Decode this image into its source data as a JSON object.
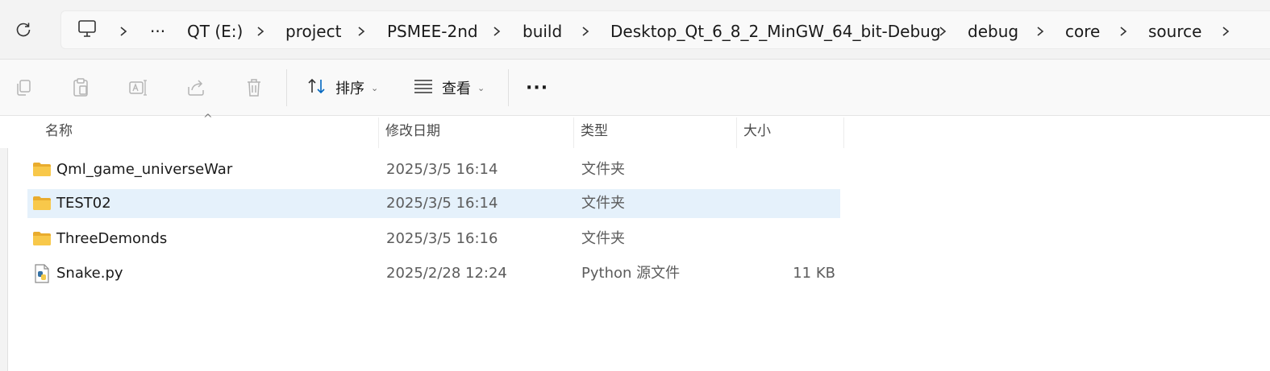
{
  "breadcrumbs": [
    {
      "label": "···"
    },
    {
      "label": "QT (E:)"
    },
    {
      "label": "project"
    },
    {
      "label": "PSMEE-2nd"
    },
    {
      "label": "build"
    },
    {
      "label": "Desktop_Qt_6_8_2_MinGW_64_bit-Debug"
    },
    {
      "label": "debug"
    },
    {
      "label": "core"
    },
    {
      "label": "source"
    }
  ],
  "toolbar": {
    "sort_label": "排序",
    "view_label": "查看",
    "more_label": "···"
  },
  "columns": {
    "name": "名称",
    "date": "修改日期",
    "type": "类型",
    "size": "大小"
  },
  "files": [
    {
      "name": "Qml_game_universeWar",
      "date": "2025/3/5 16:14",
      "type": "文件夹",
      "size": "",
      "icon": "folder-icon",
      "selected": false
    },
    {
      "name": "TEST02",
      "date": "2025/3/5 16:14",
      "type": "文件夹",
      "size": "",
      "icon": "folder-icon",
      "selected": true
    },
    {
      "name": "ThreeDemonds",
      "date": "2025/3/5 16:16",
      "type": "文件夹",
      "size": "",
      "icon": "folder-icon",
      "selected": false
    },
    {
      "name": "Snake.py",
      "date": "2025/2/28 12:24",
      "type": "Python 源文件",
      "size": "11 KB",
      "icon": "python-file-icon",
      "selected": false
    }
  ],
  "colors": {
    "selection": "#e5f1fb",
    "folder": "#f8c84a",
    "accent": "#0067c0"
  }
}
